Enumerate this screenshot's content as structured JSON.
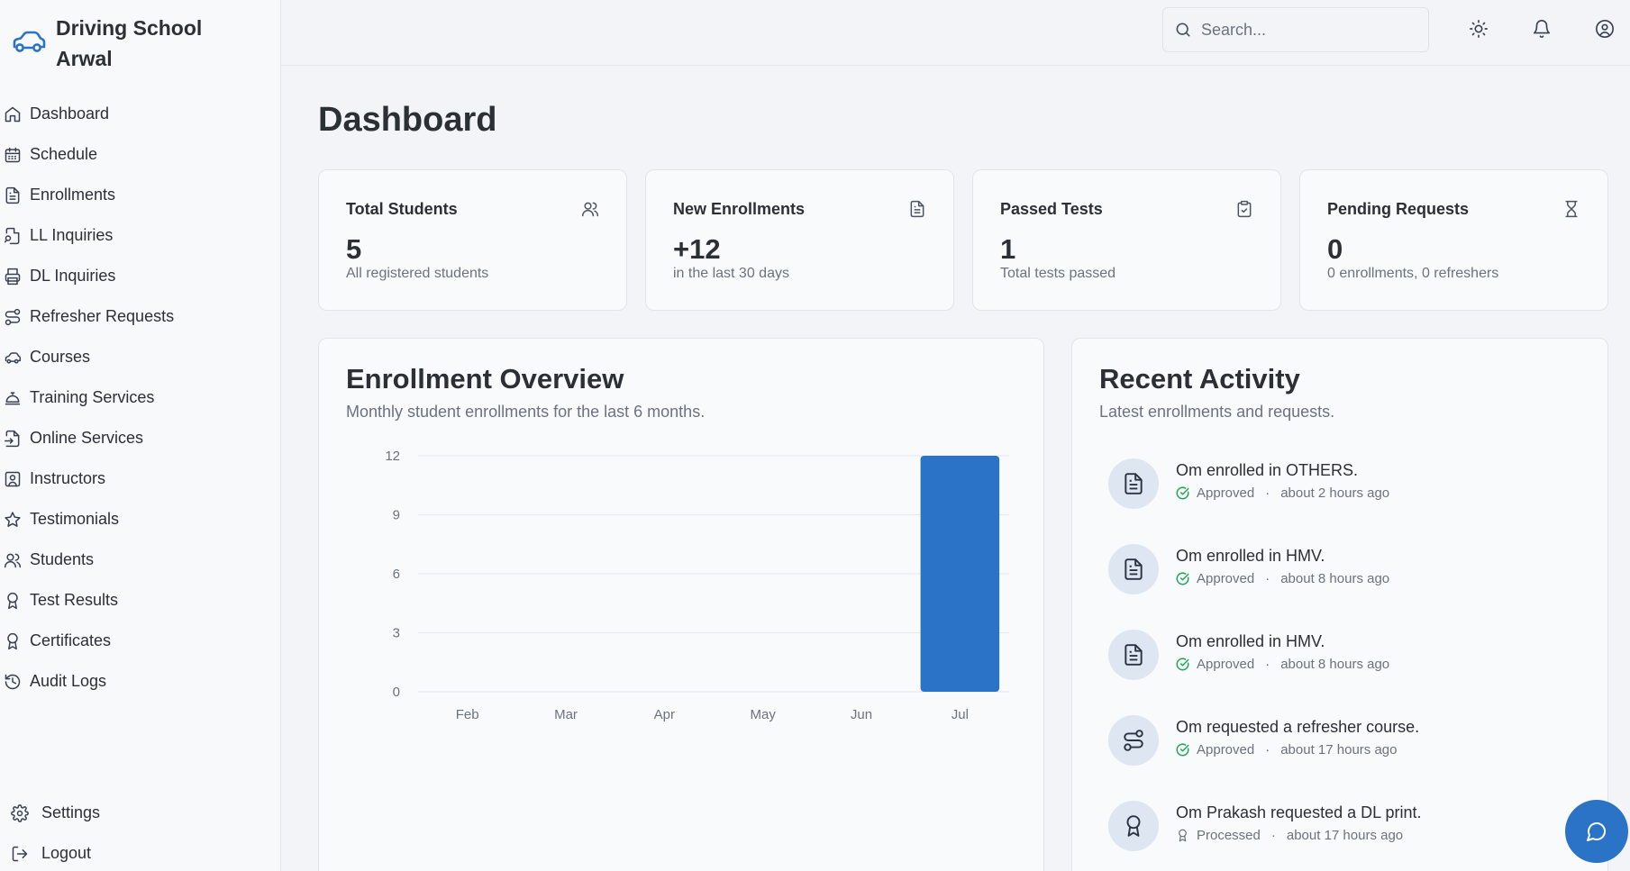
{
  "brand": {
    "name": "Driving School Arwal",
    "icon": "car-icon",
    "accent": "#2a73c6"
  },
  "sidebar": {
    "items": [
      {
        "label": "Dashboard",
        "icon": "home-icon"
      },
      {
        "label": "Schedule",
        "icon": "calendar-icon"
      },
      {
        "label": "Enrollments",
        "icon": "file-text-icon"
      },
      {
        "label": "LL Inquiries",
        "icon": "file-search-icon"
      },
      {
        "label": "DL Inquiries",
        "icon": "printer-icon"
      },
      {
        "label": "Refresher Requests",
        "icon": "route-icon"
      },
      {
        "label": "Courses",
        "icon": "car-icon"
      },
      {
        "label": "Training Services",
        "icon": "concierge-bell-icon"
      },
      {
        "label": "Online Services",
        "icon": "file-input-icon"
      },
      {
        "label": "Instructors",
        "icon": "contact-icon"
      },
      {
        "label": "Testimonials",
        "icon": "star-icon"
      },
      {
        "label": "Students",
        "icon": "users-icon"
      },
      {
        "label": "Test Results",
        "icon": "award-icon"
      },
      {
        "label": "Certificates",
        "icon": "award-icon"
      },
      {
        "label": "Audit Logs",
        "icon": "history-icon"
      }
    ],
    "bottom": [
      {
        "label": "Settings",
        "icon": "gear-icon"
      },
      {
        "label": "Logout",
        "icon": "logout-icon"
      }
    ]
  },
  "header": {
    "search_placeholder": "Search...",
    "theme_icon": "sun-icon",
    "notifications_icon": "bell-icon",
    "account_icon": "user-circle-icon"
  },
  "main": {
    "title": "Dashboard",
    "stats": [
      {
        "title": "Total Students",
        "value": "5",
        "sub": "All registered students",
        "icon": "users-icon"
      },
      {
        "title": "New Enrollments",
        "value": "+12",
        "sub": "in the last 30 days",
        "icon": "file-text-icon"
      },
      {
        "title": "Passed Tests",
        "value": "1",
        "sub": "Total tests passed",
        "icon": "clipboard-check-icon"
      },
      {
        "title": "Pending Requests",
        "value": "0",
        "sub": "0 enrollments, 0 refreshers",
        "icon": "hourglass-icon"
      }
    ],
    "overview": {
      "title": "Enrollment Overview",
      "subtitle": "Monthly student enrollments for the last 6 months."
    },
    "activity": {
      "title": "Recent Activity",
      "subtitle": "Latest enrollments and requests.",
      "items": [
        {
          "text": "Om enrolled in OTHERS.",
          "status": "Approved",
          "time": "about 2 hours ago",
          "icon": "file-text-icon",
          "status_icon": "check-circle-icon"
        },
        {
          "text": "Om enrolled in HMV.",
          "status": "Approved",
          "time": "about 8 hours ago",
          "icon": "file-text-icon",
          "status_icon": "check-circle-icon"
        },
        {
          "text": "Om enrolled in HMV.",
          "status": "Approved",
          "time": "about 8 hours ago",
          "icon": "file-text-icon",
          "status_icon": "check-circle-icon"
        },
        {
          "text": "Om requested a refresher course.",
          "status": "Approved",
          "time": "about 17 hours ago",
          "icon": "route-icon",
          "status_icon": "check-circle-icon"
        },
        {
          "text": "Om Prakash requested a DL print.",
          "status": "Processed",
          "time": "about 17 hours ago",
          "icon": "award-icon",
          "status_icon": "award-icon"
        }
      ],
      "separator": "·"
    }
  },
  "chat_button_icon": "message-circle-icon",
  "colors": {
    "bar": "#2a73c6",
    "approved": "#22a65a",
    "grid": "#e5e7eb"
  },
  "chart_data": {
    "type": "bar",
    "categories": [
      "Feb",
      "Mar",
      "Apr",
      "May",
      "Jun",
      "Jul"
    ],
    "values": [
      0,
      0,
      0,
      0,
      0,
      12
    ],
    "title": "Enrollment Overview",
    "xlabel": "",
    "ylabel": "",
    "ylim": [
      0,
      12
    ],
    "yticks": [
      0,
      3,
      6,
      9,
      12
    ],
    "grid": true
  }
}
